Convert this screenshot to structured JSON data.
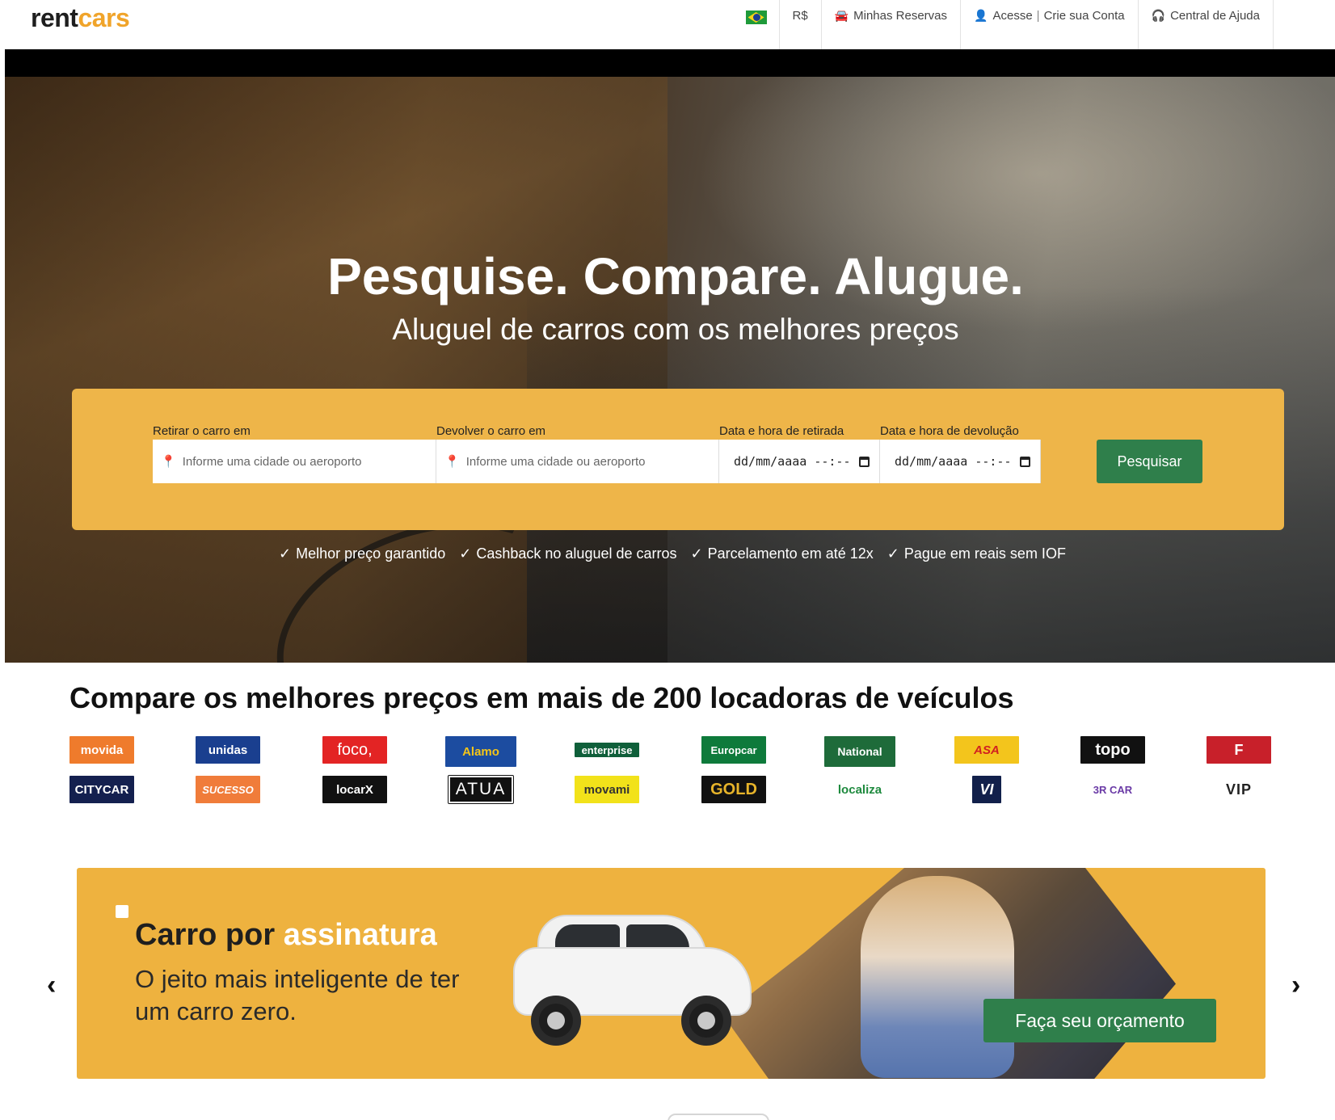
{
  "header": {
    "logo_part1": "rent",
    "logo_part2": "cars",
    "currency": "R$",
    "my_bookings": "Minhas Reservas",
    "login": "Acesse",
    "signup": "Crie sua Conta",
    "help": "Central de Ajuda",
    "separator": "|"
  },
  "hero": {
    "title": "Pesquise. Compare. Alugue.",
    "subtitle": "Aluguel de carros com os melhores preços",
    "pickup_label": "Retirar o carro em",
    "return_label": "Devolver o carro em",
    "pickup_date_label": "Data e hora de retirada",
    "return_date_label": "Data e hora de devolução",
    "pickup_placeholder": "Informe uma cidade ou aeroporto",
    "return_placeholder": "Informe uma cidade ou aeroporto",
    "date_placeholder": "dd/mm/aaaa --:--",
    "search_button": "Pesquisar",
    "benefits": [
      "Melhor preço garantido",
      "Cashback no aluguel de carros",
      "Parcelamento em até 12x",
      "Pague em reais sem IOF"
    ]
  },
  "companies": {
    "title": "Compare os melhores preços em mais de 200 locadoras de veículos",
    "row1": [
      "movida",
      "unidas",
      "foco,",
      "Alamo",
      "enterprise",
      "Europcar",
      "National",
      "ASA",
      "topo",
      "F"
    ],
    "row2": [
      "CITYCAR",
      "SUCESSO",
      "locarX",
      "ATUA",
      "movami",
      "GOLD",
      "localiza",
      "VI",
      "3R CAR",
      "VIP"
    ]
  },
  "banner": {
    "title_a": "Carro por ",
    "title_b": "assinatura",
    "subtitle": "O jeito mais inteligente de ter um carro zero.",
    "cta": "Faça seu orçamento"
  },
  "colors": {
    "accent": "#eeb549",
    "green": "#2f7f4b"
  }
}
